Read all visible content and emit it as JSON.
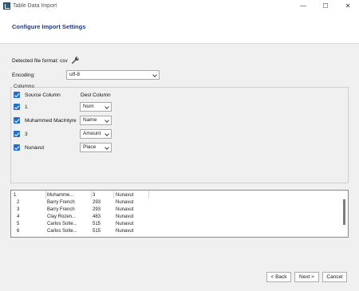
{
  "window": {
    "title": "Table Data Import",
    "minimize_glyph": "—",
    "maximize_glyph": "☐",
    "close_glyph": "✕"
  },
  "page": {
    "title": "Configure Import Settings"
  },
  "detected": {
    "label": "Detected file format: csv",
    "icon": "wrench-icon"
  },
  "encoding": {
    "label": "Encoding:",
    "value": "utf-8"
  },
  "columns": {
    "legend": "Columns:",
    "header_source": "Source Column",
    "header_dest": "Dest Column",
    "rows": [
      {
        "source": "1",
        "dest": "Num",
        "checked": true
      },
      {
        "source": "Muhammed MacIntyre",
        "dest": "Name",
        "checked": true
      },
      {
        "source": "3",
        "dest": "Amount",
        "checked": true
      },
      {
        "source": "Nunavut",
        "dest": "Place",
        "checked": true
      }
    ]
  },
  "preview": {
    "rows": [
      [
        "1",
        "Muhamme...",
        "3",
        "Nunavut"
      ],
      [
        "2",
        "Barry French",
        "293",
        "Nunavut"
      ],
      [
        "3",
        "Barry French",
        "293",
        "Nunavut"
      ],
      [
        "4",
        "Clay Rozen...",
        "483",
        "Nunavut"
      ],
      [
        "5",
        "Carlos Solte...",
        "515",
        "Nunavut"
      ],
      [
        "6",
        "Carlos Solte...",
        "515",
        "Nunavut"
      ]
    ]
  },
  "buttons": {
    "back": "< Back",
    "next": "Next >",
    "cancel": "Cancel"
  },
  "colors": {
    "accent": "#1e6ed8",
    "title": "#1f3a87"
  }
}
